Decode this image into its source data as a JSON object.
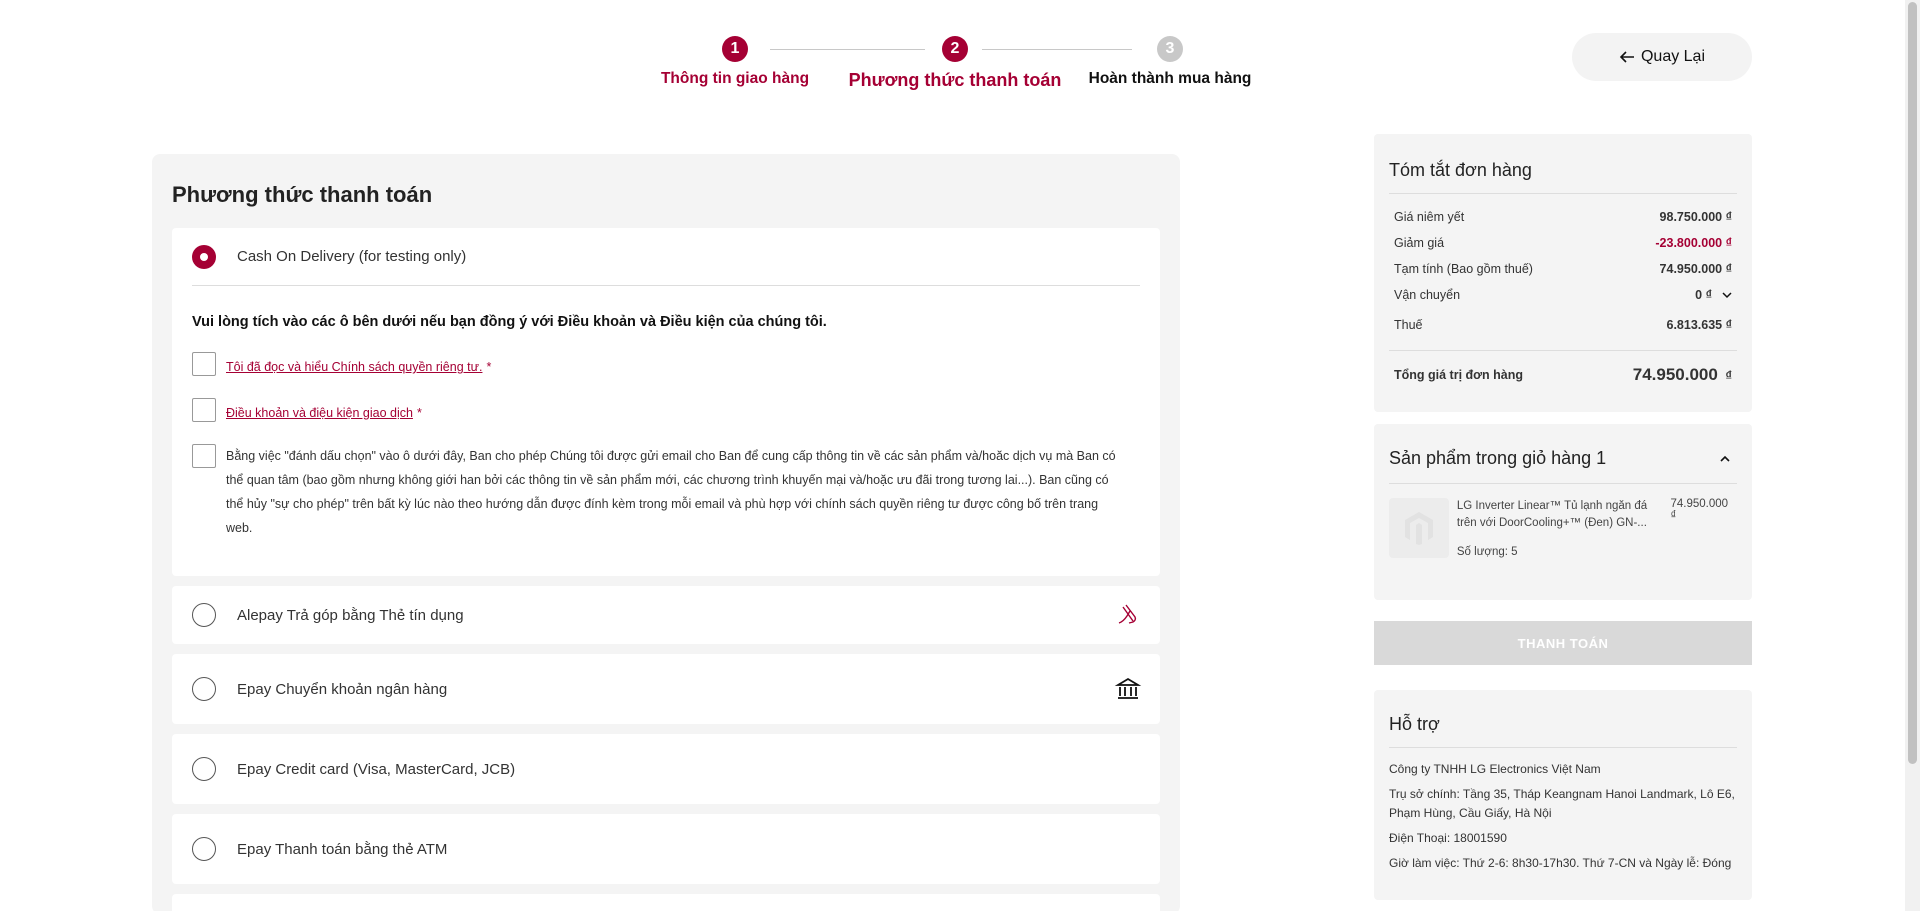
{
  "stepper": {
    "steps": [
      {
        "number": "1",
        "label": "Thông tin giao hàng",
        "state": "done"
      },
      {
        "number": "2",
        "label": "Phương thức thanh toán",
        "state": "current"
      },
      {
        "number": "3",
        "label": "Hoàn thành mua hàng",
        "state": "pending"
      }
    ]
  },
  "header": {
    "back_label": "Quay Lại"
  },
  "payment": {
    "title": "Phương thức thanh toán",
    "selected": {
      "label": "Cash On Delivery (for testing only)",
      "terms_heading": "Vui lòng tích vào các ô bên dưới nếu bạn đồng ý với Điều khoản và Điều kiện của chúng tôi.",
      "privacy_link": "Tôi đã đọc và hiểu Chính sách quyền riêng tư.",
      "terms_link": "Điều khoản và điệu kiện giao dịch",
      "required_mark": "*",
      "consent_text": "Bằng việc \"đánh dấu chọn\" vào ô dưới đây, Ban cho phép Chúng tôi được gửi email cho Ban để cung cấp thông tin về các sản phẩm và/hoăc dịch vụ mà Ban có thể quan tâm (bao gồm nhưng không giới han bởi các thông tin về sản phẩm mới, các chương trình khuyến mại và/hoặc ưu đãi trong tương lai...). Ban cũng có thể hủy \"sự cho phép\" trên bất kỳ lúc nào theo hướng dẫn được đính kèm trong mỗi email và phù hợp với chính sách quyền riêng tư được công bố trên trang web."
    },
    "methods": [
      {
        "label": "Alepay Trả góp bằng Thẻ tín dụng",
        "icon": "hand-card-icon"
      },
      {
        "label": "Epay Chuyển khoản ngân hàng",
        "icon": "bank-icon"
      },
      {
        "label": "Epay Credit card (Visa, MasterCard, JCB)",
        "icon": ""
      },
      {
        "label": "Epay Thanh toán bằng thẻ ATM",
        "icon": ""
      }
    ]
  },
  "summary": {
    "title": "Tóm tắt đơn hàng",
    "rows": [
      {
        "label": "Giá niêm yết",
        "value": "98.750.000 ₫"
      },
      {
        "label": "Giảm giá",
        "value": "-23.800.000 ₫"
      },
      {
        "label": "Tạm tính (Bao gồm thuế)",
        "value": "74.950.000 ₫"
      },
      {
        "label": "Vận chuyển",
        "value": "0 ₫"
      },
      {
        "label": "Thuế",
        "value": "6.813.635 ₫"
      }
    ],
    "total_label": "Tổng giá trị đơn hàng",
    "total_value": "74.950.000",
    "total_currency": "₫"
  },
  "cart": {
    "title": "Sản phẩm trong giỏ hàng 1",
    "item": {
      "name": "LG Inverter Linear™ Tủ lạnh ngăn đá trên với DoorCooling+™ (Đen) GN-...",
      "price": "74.950.000 ₫",
      "quantity": "Số lượng: 5"
    }
  },
  "checkout_button": "THANH TOÁN",
  "support": {
    "title": "Hỗ trợ",
    "company": "Công ty TNHH LG Electronics Việt Nam",
    "address": "Trụ sở chính: Tầng 35, Tháp Keangnam Hanoi Landmark, Lô E6, Phạm Hùng, Cầu Giấy, Hà Nội",
    "phone": "Điện Thoại: 18001590",
    "hours": "Giờ làm việc: Thứ 2-6: 8h30-17h30. Thứ 7-CN và Ngày lễ: Đóng"
  },
  "colors": {
    "brand": "#a50034",
    "panel": "#f4f4f4",
    "disabled": "#d9d9d9"
  }
}
